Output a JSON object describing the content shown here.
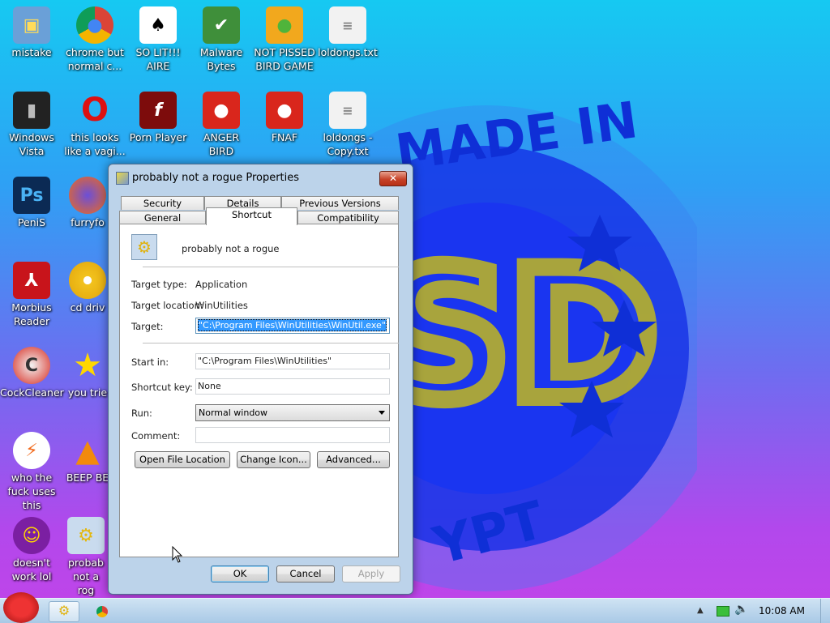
{
  "desktop": {
    "icons": [
      {
        "label": "mistake",
        "icon": "computer-icon"
      },
      {
        "label": "chrome but normal c...",
        "icon": "chrome-icon"
      },
      {
        "label": "SO LIT!!! AIRE",
        "icon": "solitaire-icon"
      },
      {
        "label": "Malware Bytes",
        "icon": "shield-icon"
      },
      {
        "label": "NOT PISSED BIRD GAME",
        "icon": "pig-icon"
      },
      {
        "label": "loldongs.txt",
        "icon": "text-file-icon"
      },
      {
        "label": "Windows Vista",
        "icon": "bin-icon"
      },
      {
        "label": "this looks like a vagi...",
        "icon": "opera-icon"
      },
      {
        "label": "Porn Player",
        "icon": "flash-icon"
      },
      {
        "label": "ANGER BIRD",
        "icon": "angry-bird-icon"
      },
      {
        "label": "FNAF",
        "icon": "angry-bird-icon"
      },
      {
        "label": "loldongs - Copy.txt",
        "icon": "text-file-icon"
      },
      {
        "label": "PeniS",
        "icon": "photoshop-icon"
      },
      {
        "label": "furryfo",
        "icon": "firefox-icon"
      },
      {
        "label": "Morbius Reader",
        "icon": "pdf-icon"
      },
      {
        "label": "cd driv",
        "icon": "cd-icon"
      },
      {
        "label": "CockCleaner",
        "icon": "ccleaner-icon"
      },
      {
        "label": "you trie",
        "icon": "star-icon"
      },
      {
        "label": "who the fuck uses this",
        "icon": "lightning-icon"
      },
      {
        "label": "BEEP BE",
        "icon": "vlc-icon"
      },
      {
        "label": "doesn't work lol",
        "icon": "yahoo-icon"
      },
      {
        "label": "probab not a rog",
        "icon": "shortcut-gear-icon"
      }
    ]
  },
  "wallpaper": {
    "top_text": "MADE IN",
    "center_text": "SD",
    "bottom_text": "EGYPT",
    "bottom_visible": "YPT"
  },
  "dialog": {
    "title": "probably not a rogue Properties",
    "close": "✕",
    "tabs_row1": [
      "Security",
      "Details",
      "Previous Versions"
    ],
    "tabs_row2": [
      "General",
      "Shortcut",
      "Compatibility"
    ],
    "active_tab": "Shortcut",
    "shortcut_name": "probably not a rogue",
    "target_type_label": "Target type:",
    "target_type_value": "Application",
    "target_location_label": "Target location:",
    "target_location_value": "WinUtilities",
    "target_label": "Target:",
    "target_value": "\"C:\\Program Files\\WinUtilities\\WinUtil.exe\"",
    "start_in_label": "Start in:",
    "start_in_value": "\"C:\\Program Files\\WinUtilities\"",
    "shortcut_key_label": "Shortcut key:",
    "shortcut_key_value": "None",
    "run_label": "Run:",
    "run_value": "Normal window",
    "comment_label": "Comment:",
    "comment_value": "",
    "buttons": {
      "open_location": "Open File Location",
      "change_icon": "Change Icon...",
      "advanced": "Advanced...",
      "ok": "OK",
      "cancel": "Cancel",
      "apply": "Apply"
    }
  },
  "taskbar": {
    "clock": "10:08 AM",
    "tray_up": "▲"
  }
}
